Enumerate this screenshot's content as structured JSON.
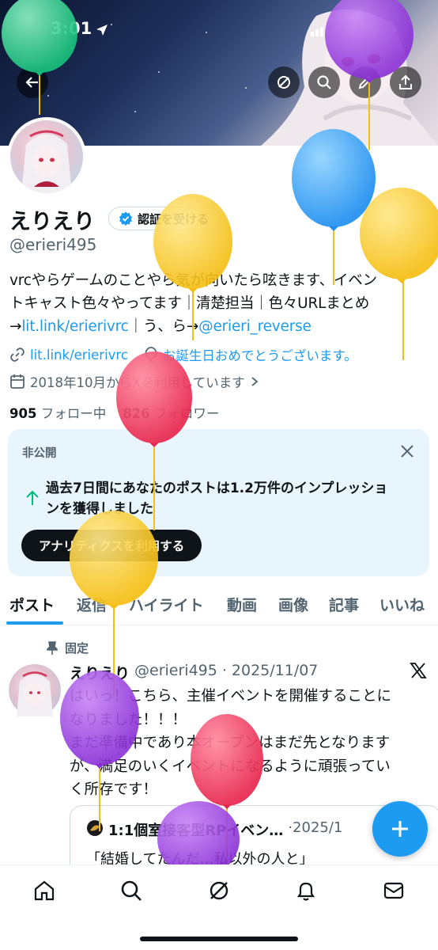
{
  "status_bar": {
    "time": "3:01"
  },
  "profile": {
    "name": "えりえり",
    "verify_label": "認証を受ける",
    "handle": "@erieri495",
    "bio_line1": "vrcやらゲームのことやら気が向いたら呟きます、イベン",
    "bio_line2": "トキャスト色々やってます｜清楚担当｜色々URLまとめ",
    "bio_arrow1": "→",
    "bio_link1": "lit.link/erierivrc",
    "bio_sep": "｜う、ら→",
    "bio_link2": "@erieri_reverse",
    "website": "lit.link/erierivrc",
    "birthday": "お誕生日おめでとうございます。",
    "joined": "2018年10月からXを利用しています",
    "following_count": "905",
    "following_label": "フォロー中",
    "followers_count": "826",
    "followers_label": "フォロワー"
  },
  "private_card": {
    "header": "非公開",
    "message_line1": "過去7日間にあなたのポストは1.2万件のインプレッショ",
    "message_line2": "ンを獲得しました",
    "button": "アナリティクスを利用する"
  },
  "tabs": [
    "ポスト",
    "返信",
    "ハイライト",
    "動画",
    "画像",
    "記事",
    "いいね"
  ],
  "pinned_post": {
    "pinned_label": "固定",
    "author": "えりえり",
    "handle": "@erieri495",
    "dot": "·",
    "date": "2025/11/07",
    "body_line1": "はいっ！こちら、主催イベントを開催することに",
    "body_line2": "なりました！！！",
    "body_line3": "まだ準備中であり本オープンはまだ先となります",
    "body_line4": "が、満足のいくイベントになるように頑張ってい",
    "body_line5": "く所存です！",
    "quote_title": "1:1個室接客型RPイベン…",
    "quote_date": "·2025/1",
    "quote_body": "「結婚してたんだ…私以外の人と」"
  },
  "icons": {
    "back": "back-arrow-icon",
    "grok": "grok-icon",
    "search": "search-icon",
    "edit": "edit-icon",
    "share": "share-icon",
    "verified": "verified-badge-icon",
    "link": "link-icon",
    "balloon": "balloon-icon",
    "calendar": "calendar-icon",
    "close": "close-icon",
    "impression_arrow": "arrow-up-icon",
    "pin": "pin-icon",
    "x_logo": "x-logo-icon",
    "compose": "plus-icon",
    "nav": [
      "home-icon",
      "search-icon",
      "grok-icon",
      "bell-icon",
      "mail-icon"
    ]
  },
  "colors": {
    "accent": "#1d9bf0",
    "text": "#0f1419",
    "muted": "#536471",
    "card_bg": "#e8f5fd"
  }
}
